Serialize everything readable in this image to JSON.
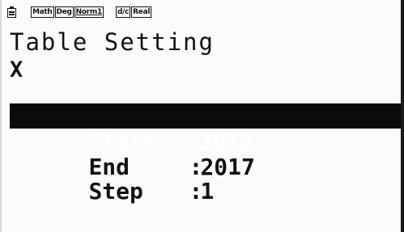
{
  "status": {
    "badges": [
      "Math",
      "Deg",
      "Norm1",
      "d/c",
      "Real"
    ]
  },
  "screen": {
    "title": "Table Setting",
    "variable": "X"
  },
  "settings": [
    {
      "label": "Start",
      "value": "2012",
      "selected": true
    },
    {
      "label": "End",
      "value": "2017",
      "selected": false
    },
    {
      "label": "Step",
      "value": "1",
      "selected": false
    }
  ],
  "icons": {
    "status": "battery-icon"
  }
}
